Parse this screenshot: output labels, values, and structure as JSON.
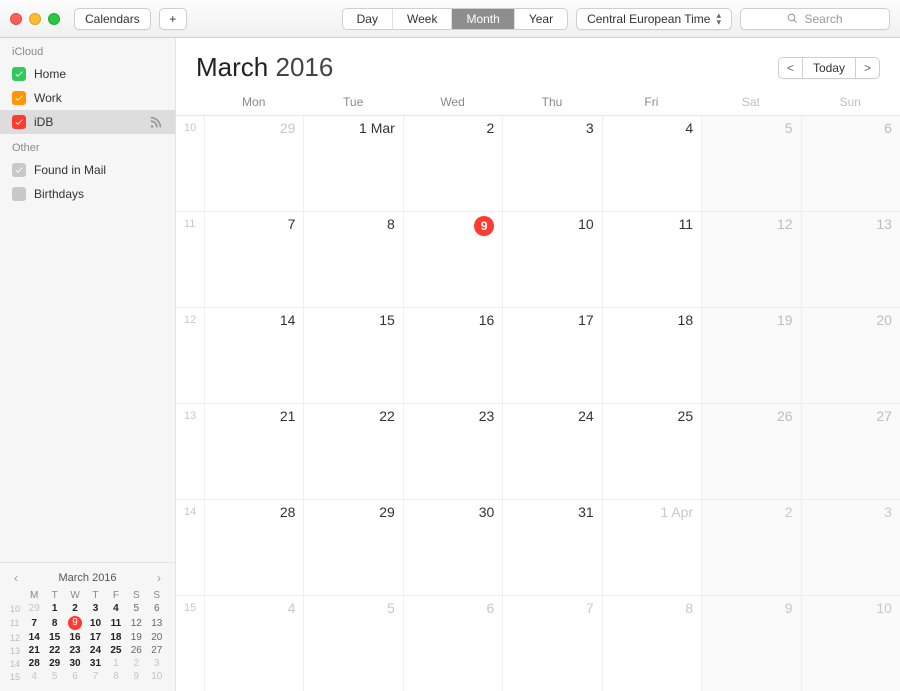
{
  "toolbar": {
    "calendars_label": "Calendars",
    "add_label": "+",
    "views": {
      "day": "Day",
      "week": "Week",
      "month": "Month",
      "year": "Year"
    },
    "active_view": "month",
    "timezone": "Central European Time",
    "search_placeholder": "Search"
  },
  "sidebar": {
    "groups": [
      {
        "title": "iCloud",
        "items": [
          {
            "label": "Home",
            "color": "green",
            "checked": true
          },
          {
            "label": "Work",
            "color": "orange",
            "checked": true
          },
          {
            "label": "iDB",
            "color": "red",
            "checked": true,
            "selected": true,
            "shared": true
          }
        ]
      },
      {
        "title": "Other",
        "items": [
          {
            "label": "Found in Mail",
            "color": "grey",
            "checked": true
          },
          {
            "label": "Birthdays",
            "color": "grey",
            "checked": false
          }
        ]
      }
    ]
  },
  "header": {
    "month": "March",
    "year": "2016",
    "today_label": "Today"
  },
  "weekdays": [
    "Mon",
    "Tue",
    "Wed",
    "Thu",
    "Fri",
    "Sat",
    "Sun"
  ],
  "grid": {
    "rows": [
      {
        "wk": "10",
        "cells": [
          {
            "label": "29",
            "out": true
          },
          {
            "label": "1 Mar"
          },
          {
            "label": "2"
          },
          {
            "label": "3"
          },
          {
            "label": "4"
          },
          {
            "label": "5",
            "wknd": true
          },
          {
            "label": "6",
            "wknd": true
          }
        ]
      },
      {
        "wk": "11",
        "cells": [
          {
            "label": "7"
          },
          {
            "label": "8"
          },
          {
            "label": "9",
            "today": true
          },
          {
            "label": "10"
          },
          {
            "label": "11"
          },
          {
            "label": "12",
            "wknd": true
          },
          {
            "label": "13",
            "wknd": true
          }
        ]
      },
      {
        "wk": "12",
        "cells": [
          {
            "label": "14"
          },
          {
            "label": "15"
          },
          {
            "label": "16"
          },
          {
            "label": "17"
          },
          {
            "label": "18"
          },
          {
            "label": "19",
            "wknd": true
          },
          {
            "label": "20",
            "wknd": true
          }
        ]
      },
      {
        "wk": "13",
        "cells": [
          {
            "label": "21"
          },
          {
            "label": "22"
          },
          {
            "label": "23"
          },
          {
            "label": "24"
          },
          {
            "label": "25"
          },
          {
            "label": "26",
            "wknd": true
          },
          {
            "label": "27",
            "wknd": true
          }
        ]
      },
      {
        "wk": "14",
        "cells": [
          {
            "label": "28"
          },
          {
            "label": "29"
          },
          {
            "label": "30"
          },
          {
            "label": "31"
          },
          {
            "label": "1 Apr",
            "out": true
          },
          {
            "label": "2",
            "wknd": true,
            "out": true
          },
          {
            "label": "3",
            "wknd": true,
            "out": true
          }
        ]
      },
      {
        "wk": "15",
        "cells": [
          {
            "label": "4",
            "out": true
          },
          {
            "label": "5",
            "out": true
          },
          {
            "label": "6",
            "out": true
          },
          {
            "label": "7",
            "out": true
          },
          {
            "label": "8",
            "out": true
          },
          {
            "label": "9",
            "wknd": true,
            "out": true
          },
          {
            "label": "10",
            "wknd": true,
            "out": true
          }
        ]
      }
    ]
  },
  "mini": {
    "title": "March 2016",
    "weekdays": [
      "M",
      "T",
      "W",
      "T",
      "F",
      "S",
      "S"
    ],
    "rows": [
      {
        "wk": "10",
        "days": [
          {
            "n": "29",
            "out": true
          },
          {
            "n": "1",
            "b": true
          },
          {
            "n": "2",
            "b": true
          },
          {
            "n": "3",
            "b": true
          },
          {
            "n": "4",
            "b": true
          },
          {
            "n": "5"
          },
          {
            "n": "6"
          }
        ]
      },
      {
        "wk": "11",
        "days": [
          {
            "n": "7",
            "b": true
          },
          {
            "n": "8",
            "b": true
          },
          {
            "n": "9",
            "today": true
          },
          {
            "n": "10",
            "b": true
          },
          {
            "n": "11",
            "b": true
          },
          {
            "n": "12"
          },
          {
            "n": "13"
          }
        ]
      },
      {
        "wk": "12",
        "days": [
          {
            "n": "14",
            "b": true
          },
          {
            "n": "15",
            "b": true
          },
          {
            "n": "16",
            "b": true
          },
          {
            "n": "17",
            "b": true
          },
          {
            "n": "18",
            "b": true
          },
          {
            "n": "19"
          },
          {
            "n": "20"
          }
        ]
      },
      {
        "wk": "13",
        "days": [
          {
            "n": "21",
            "b": true
          },
          {
            "n": "22",
            "b": true
          },
          {
            "n": "23",
            "b": true
          },
          {
            "n": "24",
            "b": true
          },
          {
            "n": "25",
            "b": true
          },
          {
            "n": "26"
          },
          {
            "n": "27"
          }
        ]
      },
      {
        "wk": "14",
        "days": [
          {
            "n": "28",
            "b": true
          },
          {
            "n": "29",
            "b": true
          },
          {
            "n": "30",
            "b": true
          },
          {
            "n": "31",
            "b": true
          },
          {
            "n": "1",
            "out": true
          },
          {
            "n": "2",
            "out": true
          },
          {
            "n": "3",
            "out": true
          }
        ]
      },
      {
        "wk": "15",
        "days": [
          {
            "n": "4",
            "out": true
          },
          {
            "n": "5",
            "out": true
          },
          {
            "n": "6",
            "out": true
          },
          {
            "n": "7",
            "out": true
          },
          {
            "n": "8",
            "out": true
          },
          {
            "n": "9",
            "out": true
          },
          {
            "n": "10",
            "out": true
          }
        ]
      }
    ]
  }
}
